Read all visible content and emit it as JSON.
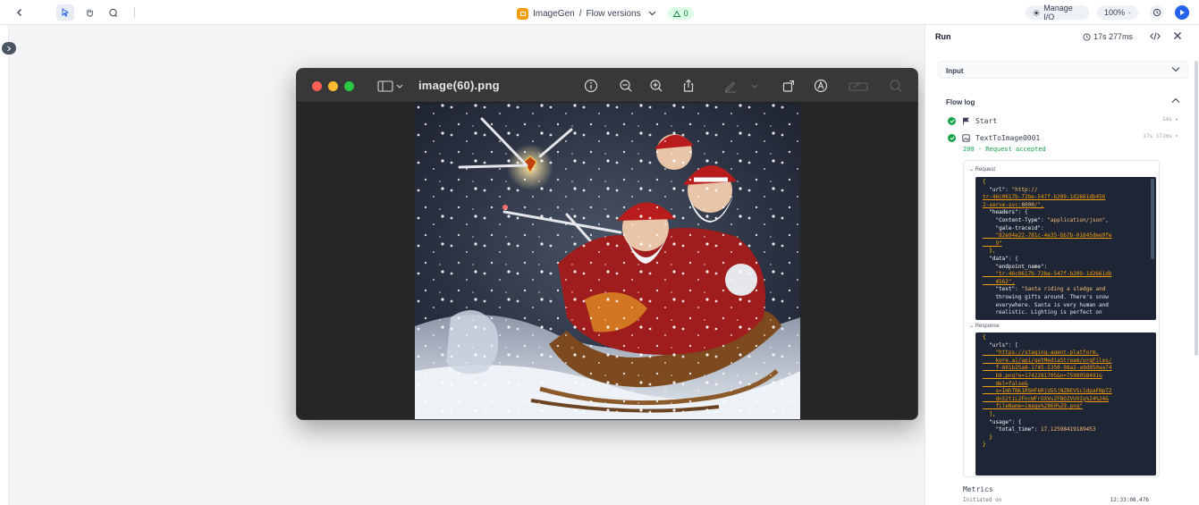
{
  "toolbar": {
    "breadcrumb_app": "ImageGen",
    "breadcrumb_sep": "/",
    "breadcrumb_page": "Flow versions",
    "warnings_count": "0",
    "manage_io_label": "Manage I/O",
    "zoom_label": "100%",
    "icons": [
      "back-icon",
      "pointer-icon",
      "hand-icon",
      "comment-icon",
      "sun-icon",
      "chevron-down-icon",
      "history-icon",
      "play-icon"
    ]
  },
  "viewer": {
    "filename": "image(60).png",
    "icons": [
      "sidebar-icon",
      "info-icon",
      "zoom-out-icon",
      "zoom-in-icon",
      "share-icon",
      "markup-icon",
      "rotate-icon",
      "annotate-icon",
      "redact-icon",
      "search-icon"
    ]
  },
  "run_panel": {
    "title": "Run",
    "duration": "17s 277ms",
    "input_label": "Input",
    "flow_log_label": "Flow log",
    "steps": [
      {
        "name": "Start",
        "duration": "1ms"
      },
      {
        "name": "TextToImage0001",
        "duration": "17s 172ms"
      }
    ],
    "status": "200 - Request accepted",
    "request_label": "Request",
    "response_label": "Response",
    "request_lines": [
      "{",
      "  \"url\": \"http://",
      "tr-46c0617b-72be-547f-b209-1d2661db456",
      "2-serve-svc:8000/\",",
      "  \"headers\": {",
      "    \"Content-Type\": \"application/json\",",
      "    \"gale-traceid\":",
      "    \"82e94e22-781c-4e35-bb7b-01845dee9fe",
      "    9\"",
      "  },",
      "  \"data\": {",
      "    \"endpoint_name\":",
      "    \"tr-46c0617b-72be-547f-b209-1d2661db",
      "    4562\",",
      "    \"text\": \"Santa riding a sledge and",
      "    throwing gifts around. There's snow",
      "    everywhere. Santa is very human and",
      "    realistic. Lighting is perfect on"
    ],
    "response_lines": [
      "{",
      "  \"urls\": [",
      "    \"https://staging-agent-platform.",
      "    kore.ai/api/getMediaStream/orgFiles/",
      "    f-601b25a8-1745-5350-98a2-a9d950aa74",
      "    b9.png?e=1742281705&n=7598958491&",
      "    del=false&",
      "    s=ImhTNk1RSHF6RjU5SjNZNEVSc1dpaFNpT2",
      "    dnS2t1L2FncWFrOXVuZFBOZVU9Ig%24%24&",
      "    fileName=image%2860%29.png\"",
      "  ],",
      "  \"usage\": {",
      "    \"total_time\": 17.12598419189453",
      "  }",
      "}"
    ],
    "metrics_label": "Metrics",
    "initiated_label": "Initiated on",
    "initiated_value": "12:33:08.476"
  },
  "colors": {
    "accent": "#2563eb",
    "success": "#16a34a",
    "app_badge": "#f59e0b",
    "code_bg": "#1e2535"
  }
}
